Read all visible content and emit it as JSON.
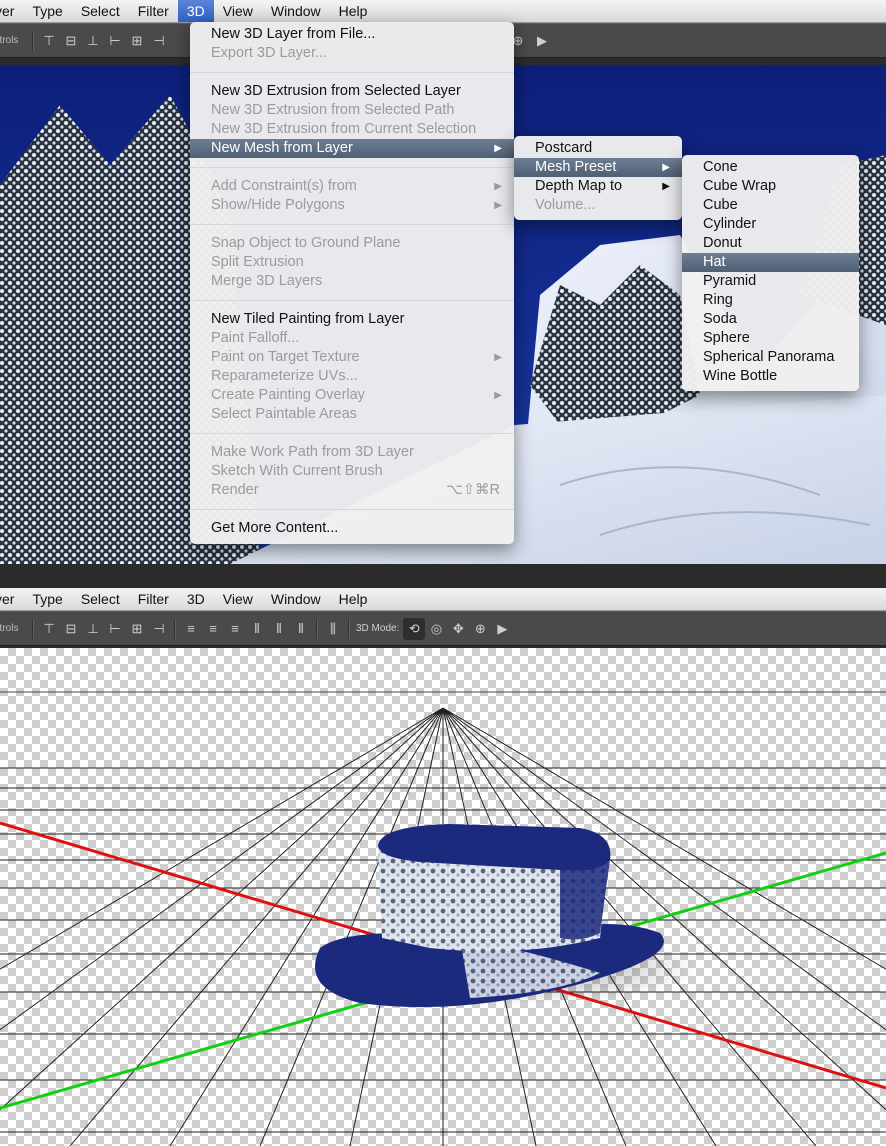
{
  "top_menubar": {
    "items": [
      "yer",
      "Type",
      "Select",
      "Filter",
      "3D",
      "View",
      "Window",
      "Help"
    ],
    "active": "3D"
  },
  "top_options": {
    "label": "ntrols"
  },
  "menu_3d": {
    "items": [
      {
        "label": "New 3D Layer from File...",
        "enabled": true
      },
      {
        "label": "Export 3D Layer...",
        "enabled": false
      },
      {
        "label": "New 3D Extrusion from Selected Layer",
        "enabled": true
      },
      {
        "label": "New 3D Extrusion from Selected Path",
        "enabled": false
      },
      {
        "label": "New 3D Extrusion from Current Selection",
        "enabled": false
      },
      {
        "label": "New Mesh from Layer",
        "enabled": true,
        "highlighted": true,
        "submenu": true
      },
      {
        "label": "Add Constraint(s) from",
        "enabled": false,
        "submenu": true
      },
      {
        "label": "Show/Hide Polygons",
        "enabled": false,
        "submenu": true
      },
      {
        "label": "Snap Object to Ground Plane",
        "enabled": false
      },
      {
        "label": "Split Extrusion",
        "enabled": false
      },
      {
        "label": "Merge 3D Layers",
        "enabled": false
      },
      {
        "label": "New Tiled Painting from Layer",
        "enabled": true
      },
      {
        "label": "Paint Falloff...",
        "enabled": false
      },
      {
        "label": "Paint on Target Texture",
        "enabled": false,
        "submenu": true
      },
      {
        "label": "Reparameterize UVs...",
        "enabled": false
      },
      {
        "label": "Create Painting Overlay",
        "enabled": false,
        "submenu": true
      },
      {
        "label": "Select Paintable Areas",
        "enabled": false
      },
      {
        "label": "Make Work Path from 3D Layer",
        "enabled": false
      },
      {
        "label": "Sketch With Current Brush",
        "enabled": false
      },
      {
        "label": "Render",
        "enabled": false,
        "shortcut": "⌥⇧⌘R"
      },
      {
        "label": "Get More Content...",
        "enabled": true
      }
    ]
  },
  "submenu_mesh": {
    "items": [
      {
        "label": "Postcard",
        "enabled": true
      },
      {
        "label": "Mesh Preset",
        "enabled": true,
        "highlighted": true,
        "submenu": true
      },
      {
        "label": "Depth Map to",
        "enabled": true,
        "submenu": true
      },
      {
        "label": "Volume...",
        "enabled": false
      }
    ]
  },
  "submenu_preset": {
    "items": [
      "Cone",
      "Cube Wrap",
      "Cube",
      "Cylinder",
      "Donut",
      "Hat",
      "Pyramid",
      "Ring",
      "Soda",
      "Sphere",
      "Spherical Panorama",
      "Wine Bottle"
    ],
    "highlighted": "Hat"
  },
  "bottom_menubar": {
    "items": [
      "yer",
      "Type",
      "Select",
      "Filter",
      "3D",
      "View",
      "Window",
      "Help"
    ]
  },
  "bottom_options": {
    "label": "ntrols",
    "mode_label": "3D Mode:"
  },
  "colors": {
    "highlight": "#56667b",
    "menubar_active": "#3a6bcc",
    "axis_x": "#e01010",
    "axis_y": "#10d010",
    "hat_blue": "#1a2a7a"
  }
}
